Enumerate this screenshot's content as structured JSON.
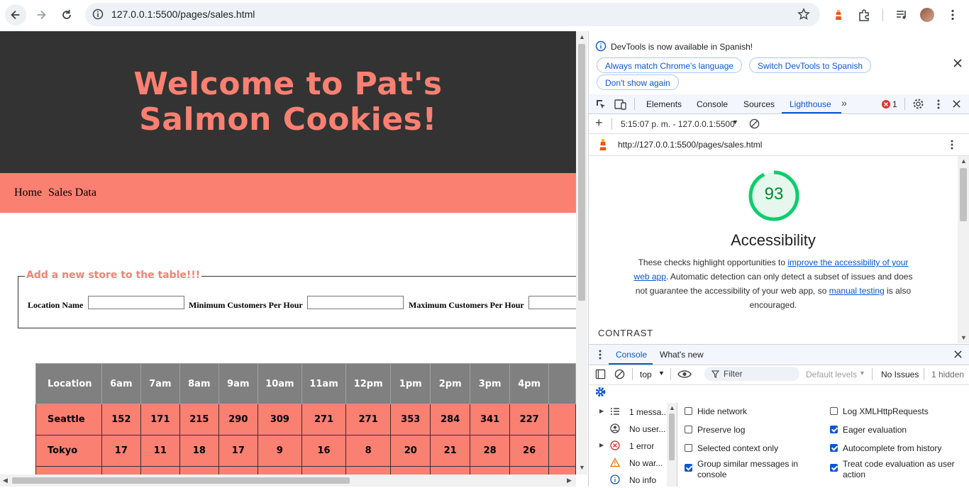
{
  "browser": {
    "url": "127.0.0.1:5500/pages/sales.html"
  },
  "page": {
    "title": "Welcome to Pat's Salmon Cookies!",
    "nav": [
      "Home",
      "Sales Data"
    ],
    "form": {
      "legend": "Add a new store to the table!!!",
      "labels": [
        "Location Name",
        "Minimum Customers Per Hour",
        "Maximum Customers Per Hour"
      ]
    },
    "table": {
      "headers": [
        "Location",
        "6am",
        "7am",
        "8am",
        "9am",
        "10am",
        "11am",
        "12pm",
        "1pm",
        "2pm",
        "3pm",
        "4pm"
      ],
      "rows": [
        [
          "Seattle",
          "152",
          "171",
          "215",
          "290",
          "309",
          "271",
          "271",
          "353",
          "284",
          "341",
          "227"
        ],
        [
          "Tokyo",
          "17",
          "11",
          "18",
          "17",
          "9",
          "16",
          "8",
          "20",
          "21",
          "28",
          "26"
        ]
      ]
    }
  },
  "devtools": {
    "banner": {
      "message": "DevTools is now available in Spanish!",
      "buttons": [
        "Always match Chrome's language",
        "Switch DevTools to Spanish",
        "Don't show again"
      ]
    },
    "tabs": [
      "Elements",
      "Console",
      "Sources",
      "Lighthouse"
    ],
    "active_tab": "Lighthouse",
    "error_count": "1",
    "lighthouse": {
      "report_selector": "5:15:07 p. m. - 127.0.0.1:5500",
      "report_url": "http://127.0.0.1:5500/pages/sales.html",
      "score": 93,
      "category": "Accessibility",
      "desc_1": "These checks highlight opportunities to ",
      "desc_link_1": "improve the accessibility of your web app",
      "desc_2": ". Automatic detection can only detect a subset of issues and does not guarantee the accessibility of your web app, so ",
      "desc_link_2": "manual testing",
      "desc_3": " is also encouraged.",
      "section": "CONTRAST"
    },
    "drawer": {
      "tabs": [
        "Console",
        "What's new"
      ],
      "context": "top",
      "filter_placeholder": "Filter",
      "levels": "Default levels",
      "issues": "No Issues",
      "hidden": "1 hidden",
      "sidebar": [
        "1 messa...",
        "No user...",
        "1 error",
        "No war...",
        "No info"
      ],
      "options_left": [
        {
          "label": "Hide network",
          "checked": false
        },
        {
          "label": "Preserve log",
          "checked": false
        },
        {
          "label": "Selected context only",
          "checked": false
        },
        {
          "label": "Group similar messages in console",
          "checked": true
        }
      ],
      "options_right": [
        {
          "label": "Log XMLHttpRequests",
          "checked": false
        },
        {
          "label": "Eager evaluation",
          "checked": true
        },
        {
          "label": "Autocomplete from history",
          "checked": true
        },
        {
          "label": "Treat code evaluation as user action",
          "checked": true
        }
      ]
    },
    "colors": {
      "accent": "#0b57d0",
      "score_green": "#0cce6b",
      "salmon": "#fa8072"
    }
  }
}
